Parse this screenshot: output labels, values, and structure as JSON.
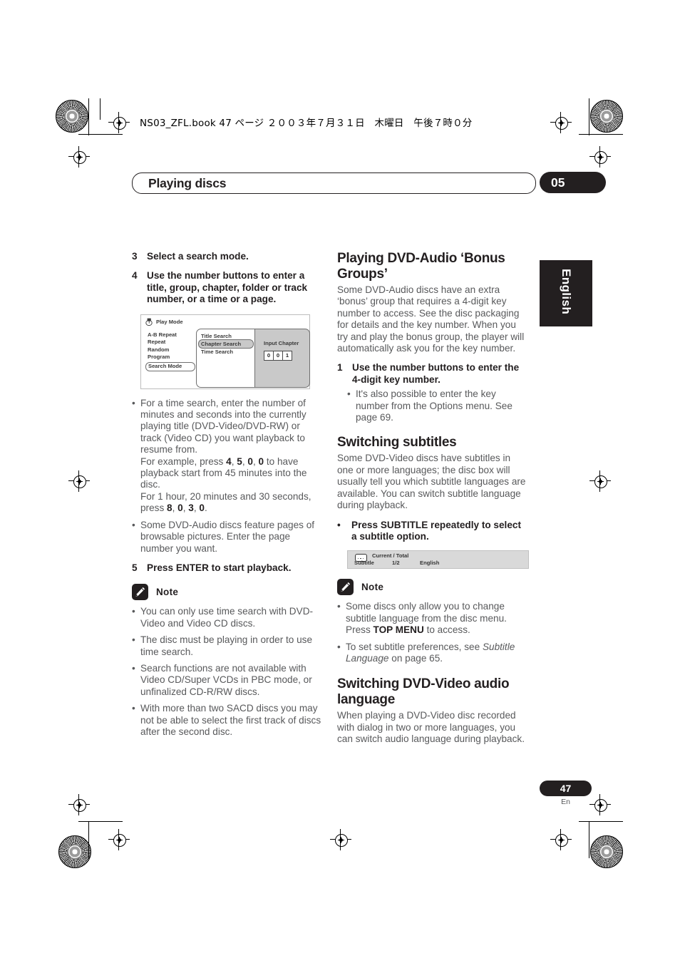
{
  "print_header": {
    "text": "NS03_ZFL.book  47 ページ  ２００３年７月３１日　木曜日　午後７時０分"
  },
  "chapter": {
    "title": "Playing discs",
    "number": "05",
    "side_tab": "English"
  },
  "footer": {
    "page_number": "47",
    "language_code": "En"
  },
  "left_column": {
    "step3": {
      "num": "3",
      "text": "Select a search mode."
    },
    "step4": {
      "num": "4",
      "text": "Use the number buttons to enter a title, group, chapter, folder or track number, or a time or a page."
    },
    "osd_play_mode": {
      "icon": "play-mode-disc-icon",
      "title": "Play Mode",
      "menu_items": [
        "A-B Repeat",
        "Repeat",
        "Random",
        "Program"
      ],
      "selected_menu_item": "Search Mode",
      "search_options": [
        "Title Search",
        "Chapter Search",
        "Time Search"
      ],
      "highlighted_option": "Chapter Search",
      "input_label": "Input Chapter",
      "input_digits": [
        "0",
        "0",
        "1"
      ]
    },
    "bullets": [
      "For a time search, enter the number of minutes and seconds into the currently playing title (DVD-Video/DVD-RW) or track (Video CD) you want playback to resume from.",
      "Some DVD-Audio discs feature pages of browsable pictures. Enter the page number you want."
    ],
    "example_line1_pre": "For example, press ",
    "example_keys1": [
      "4",
      "5",
      "0",
      "0"
    ],
    "example_line1_post": " to have playback start from 45 minutes into the disc.",
    "example_line2_pre": "For 1 hour, 20 minutes and 30 seconds, press ",
    "example_keys2": [
      "8",
      "0",
      "3",
      "0"
    ],
    "example_line2_post": ".",
    "step5": {
      "num": "5",
      "text": "Press ENTER to start playback."
    },
    "note": {
      "label": "Note",
      "icon": "pencil-note-icon",
      "items": [
        "You can only use time search with DVD-Video and Video CD discs.",
        "The disc must be playing in order to use time search.",
        "Search functions are not available with Video CD/Super VCDs in PBC mode, or unfinalized  CD-R/RW discs.",
        "With more than two SACD discs you may not be able to select the first track of discs after the second disc."
      ]
    }
  },
  "right_column": {
    "bonus_groups": {
      "heading": "Playing DVD-Audio ‘Bonus Groups’",
      "body": "Some DVD-Audio discs have an extra ‘bonus’ group that requires a 4-digit key number to access. See the disc packaging for details and the key number. When you try and play the bonus group, the player will automatically ask you for the key number.",
      "step1": {
        "num": "1",
        "text": "Use the number buttons to enter the 4-digit key number."
      },
      "bullet": "It's also possible to enter the key number from the Options menu. See page 69."
    },
    "switching_subtitles": {
      "heading": "Switching subtitles",
      "body": "Some DVD-Video discs have subtitles in one or more languages; the disc box will usually tell you which subtitle languages are available. You can switch subtitle language during playback.",
      "instruction": "Press SUBTITLE repeatedly to select a subtitle option.",
      "osd_subtitle": {
        "icon": "subtitle-box-icon",
        "current_total_label": "Current / Total",
        "field_label": "Subtitle",
        "value": "1/2",
        "language": "English"
      },
      "note": {
        "label": "Note",
        "icon": "pencil-note-icon",
        "item1_pre": "Some discs only allow you to change subtitle language from the disc menu. Press ",
        "item1_key": "TOP MENU",
        "item1_post": " to access.",
        "item2_pre": "To set subtitle preferences, see ",
        "item2_italic": "Subtitle Language",
        "item2_post": " on page 65."
      }
    },
    "dvd_video_audio": {
      "heading": "Switching DVD-Video audio language",
      "body": "When playing a DVD-Video disc recorded with dialog in two or more languages, you can switch audio language during playback."
    }
  }
}
